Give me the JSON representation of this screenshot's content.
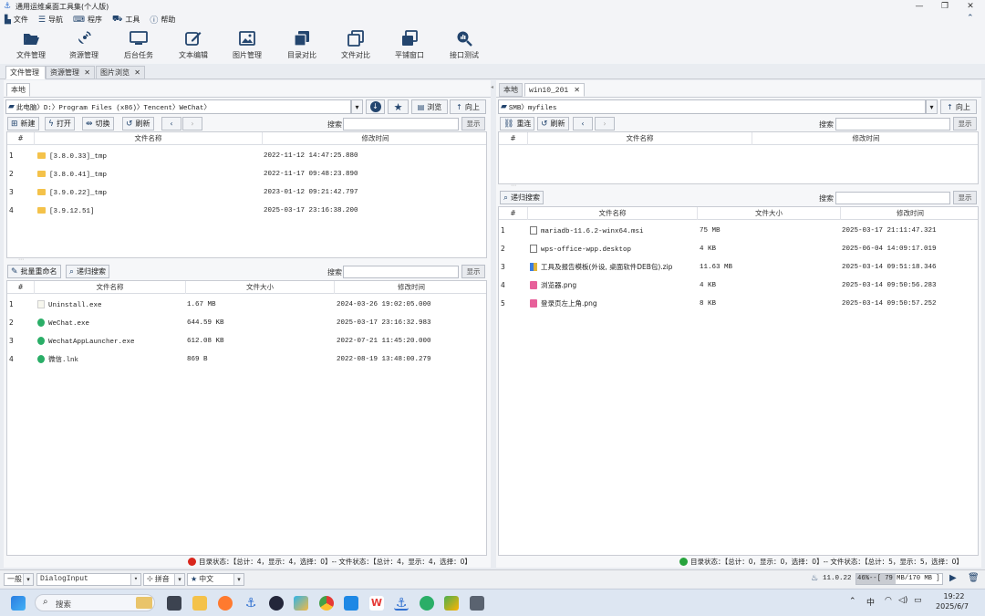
{
  "window": {
    "title": "通用运维桌面工具集(个人版)"
  },
  "menu": [
    {
      "label": "文件",
      "icon": "file-icon"
    },
    {
      "label": "导航",
      "icon": "menu-icon"
    },
    {
      "label": "程序",
      "icon": "keyboard-icon"
    },
    {
      "label": "工具",
      "icon": "toolbox-icon"
    },
    {
      "label": "帮助",
      "icon": "help-icon"
    }
  ],
  "toolbar": [
    {
      "label": "文件管理",
      "icon": "folder-open-icon"
    },
    {
      "label": "资源管理",
      "icon": "satellite-icon"
    },
    {
      "label": "后台任务",
      "icon": "monitor-icon"
    },
    {
      "label": "文本编辑",
      "icon": "edit-icon"
    },
    {
      "label": "图片管理",
      "icon": "image-icon"
    },
    {
      "label": "目录对比",
      "icon": "copy-icon"
    },
    {
      "label": "文件对比",
      "icon": "compare-icon"
    },
    {
      "label": "平铺窗口",
      "icon": "tile-windows-icon"
    },
    {
      "label": "接口测试",
      "icon": "zoom-test-icon"
    }
  ],
  "main_tabs": [
    {
      "label": "文件管理",
      "closable": false
    },
    {
      "label": "资源管理",
      "closable": true
    },
    {
      "label": "图片浏览",
      "closable": true
    }
  ],
  "left": {
    "tab": "本地",
    "path": "此电脑〉D:〉Program Files (x86)〉Tencent〉WeChat〉",
    "browse_label": "浏览",
    "up_label": "向上",
    "actions": {
      "new": "新建",
      "open": "打开",
      "switch": "切换",
      "refresh": "刷新"
    },
    "search_label": "搜索",
    "show_label": "显示",
    "dir_table": {
      "columns": [
        "#",
        "文件名称",
        "修改时间"
      ],
      "rows": [
        {
          "no": "1",
          "name": "[3.8.0.33]_tmp",
          "time": "2022-11-12 14:47:25.880"
        },
        {
          "no": "2",
          "name": "[3.8.0.41]_tmp",
          "time": "2022-11-17 09:48:23.890"
        },
        {
          "no": "3",
          "name": "[3.9.0.22]_tmp",
          "time": "2023-01-12 09:21:42.797"
        },
        {
          "no": "4",
          "name": "[3.9.12.51]",
          "time": "2025-03-17 23:16:38.200"
        }
      ]
    },
    "file_actions": {
      "rename": "批量重命名",
      "recursive": "递归搜索"
    },
    "file_table": {
      "columns": [
        "#",
        "文件名称",
        "文件大小",
        "修改时间"
      ],
      "rows": [
        {
          "no": "1",
          "name": "Uninstall.exe",
          "size": "1.67 MB",
          "time": "2024-03-26 19:02:05.000"
        },
        {
          "no": "2",
          "name": "WeChat.exe",
          "size": "644.59 KB",
          "time": "2025-03-17 23:16:32.983"
        },
        {
          "no": "3",
          "name": "WechatAppLauncher.exe",
          "size": "612.08 KB",
          "time": "2022-07-21 11:45:20.000"
        },
        {
          "no": "4",
          "name": "微信.lnk",
          "size": "869 B",
          "time": "2022-08-19 13:48:00.279"
        }
      ]
    },
    "status": "目录状态：【总计：4，显示：4，选择：0】-- 文件状态：【总计：4，显示：4，选择：0】"
  },
  "right": {
    "tabs": [
      {
        "label": "本地"
      },
      {
        "label": "win10_201"
      }
    ],
    "path": "SMB〉myfiles",
    "up_label": "向上",
    "actions": {
      "reconnect": "重连",
      "refresh": "刷新"
    },
    "search_label": "搜索",
    "show_label": "显示",
    "dir_table": {
      "columns": [
        "#",
        "文件名称",
        "修改时间"
      ],
      "rows": []
    },
    "file_actions": {
      "recursive": "递归搜索"
    },
    "file_table": {
      "columns": [
        "#",
        "文件名称",
        "文件大小",
        "修改时间"
      ],
      "rows": [
        {
          "no": "1",
          "name": "mariadb-11.6.2-winx64.msi",
          "size": "75 MB",
          "time": "2025-03-17 21:11:47.321"
        },
        {
          "no": "2",
          "name": "wps-office-wpp.desktop",
          "size": "4 KB",
          "time": "2025-06-04 14:09:17.019"
        },
        {
          "no": "3",
          "name": "工具及报告模板(外设, 桌面软件DEB包).zip",
          "size": "11.63 MB",
          "time": "2025-03-14 09:51:18.346"
        },
        {
          "no": "4",
          "name": "浏览器.png",
          "size": "4 KB",
          "time": "2025-03-14 09:50:56.283"
        },
        {
          "no": "5",
          "name": "登录页左上角.png",
          "size": "8 KB",
          "time": "2025-03-14 09:50:57.252"
        }
      ]
    },
    "status": "目录状态：【总计：0，显示：0，选择：0】-- 文件状态：【总计：5，显示：5，选择：0】"
  },
  "bottombar": {
    "level": "一般",
    "input_type": "DialogInput",
    "mode": "拼音",
    "language": "中文",
    "version": "11.0.22",
    "memory_percent": 46,
    "memory_text": "46%--[ 79 MB/170 MB ]"
  },
  "taskbar": {
    "search_placeholder": "搜索",
    "ime": "中",
    "time": "19:22",
    "date": "2025/6/7"
  },
  "colors": {
    "accent": "#2f6fd0",
    "folder": "#f4c24a",
    "status_red": "#d9261c",
    "status_green": "#27a33c"
  }
}
